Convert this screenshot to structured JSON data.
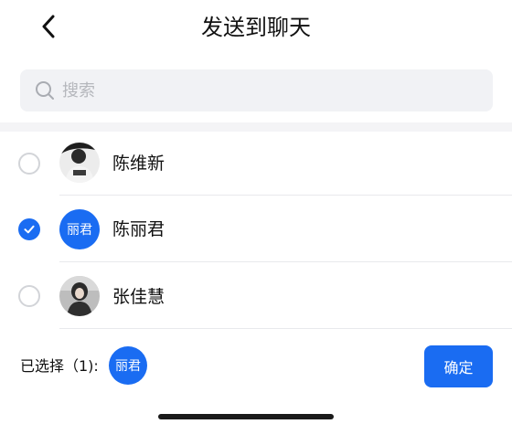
{
  "header": {
    "title": "发送到聊天",
    "back_icon": "chevron-left-icon"
  },
  "search": {
    "placeholder": "搜索",
    "value": "",
    "icon": "search-icon"
  },
  "contacts": [
    {
      "name": "陈维新",
      "selected": false,
      "avatar_type": "photo",
      "avatar_text": ""
    },
    {
      "name": "陈丽君",
      "selected": true,
      "avatar_type": "text",
      "avatar_text": "丽君"
    },
    {
      "name": "张佳慧",
      "selected": false,
      "avatar_type": "photo",
      "avatar_text": ""
    }
  ],
  "footer": {
    "selected_label": "已选择（1):",
    "selected_avatar_text": "丽君",
    "confirm_label": "确定"
  },
  "colors": {
    "accent": "#1a6cf2",
    "search_bg": "#f1f2f5",
    "divider": "#e8e9ec"
  }
}
